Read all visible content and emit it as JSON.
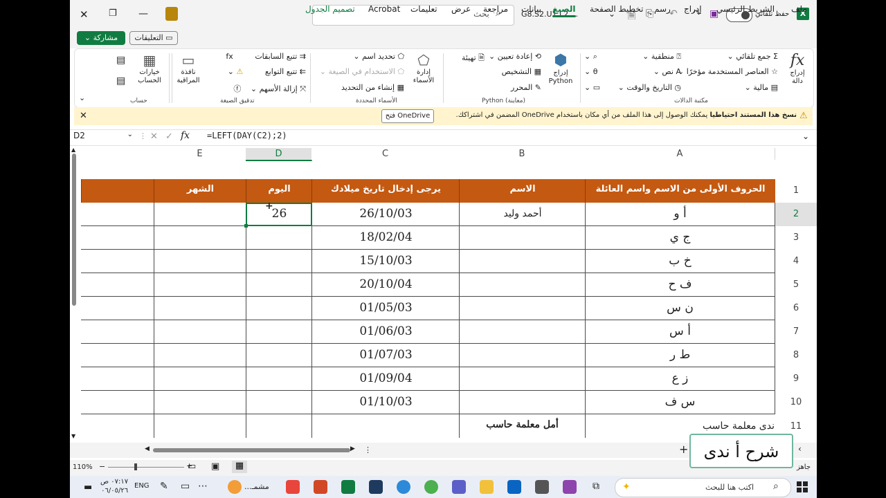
{
  "titlebar": {
    "search_placeholder": "بحث",
    "file_name": "G8.S2.U1.L2....",
    "autosave_label": "حفظ تلقائي",
    "logo_text": "X"
  },
  "tabs": [
    "ملف",
    "الشريط الرئيسي",
    "إدراج",
    "رسم",
    "تخطيط الصفحة",
    "الصيغ",
    "بيانات",
    "مراجعة",
    "عرض",
    "تعليمات",
    "Acrobat",
    "تصميم الجدول"
  ],
  "tab_active": "الصيغ",
  "share_label": "مشاركة",
  "comments_label": "التعليقات",
  "ribbon": {
    "insert_function": "إدراج دالة",
    "fx": "fx",
    "autosum": "جمع تلقائي",
    "recent": "العناصر المستخدمة مؤخرًا",
    "financial": "مالية",
    "logical": "منطقية",
    "text": "نص",
    "datetime": "التاريخ والوقت",
    "library_label": "مكتبة الدالات",
    "insert_python": "إدراج Python",
    "reset": "إعادة تعيين",
    "init": "تهيئة",
    "diagnostics": "التشخيص",
    "editor": "المحرر",
    "python_label": "Python (معاينة)",
    "name_manager": "إدارة الأسماء",
    "define_name": "تحديد اسم",
    "use_in_formula": "الاستخدام في الصيغة",
    "create_from_selection": "إنشاء من التحديد",
    "names_label": "الأسماء المحددة",
    "trace_precedents": "تتبع السابقات",
    "trace_dependents": "تتبع التوابع",
    "remove_arrows": "إزالة الأسهم",
    "auditing_label": "تدقيق الصيغة",
    "watch_window": "نافذة المراقبة",
    "calc_options": "خيارات الحساب",
    "calc_label": "حساب"
  },
  "notification": {
    "title": "نسخ هذا المستند احتياطيا",
    "message": "يمكنك الوصول إلى هذا الملف من أي مكان باستخدام OneDrive المضمن في اشتراكك.",
    "button": "فتح OneDrive"
  },
  "formula_bar": {
    "name_box": "D2",
    "fx": "fx",
    "formula": "=LEFT(DAY(C2);2)"
  },
  "columns": [
    "A",
    "B",
    "C",
    "D",
    "E"
  ],
  "rows": [
    "1",
    "2",
    "3",
    "4",
    "5",
    "6",
    "7",
    "8",
    "9",
    "10",
    "11"
  ],
  "table": {
    "headers": {
      "a": "الحروف الأولى من الاسم واسم العائلة",
      "b": "الاسم",
      "c": "يرجى إدخال تاريخ ميلادك",
      "d": "اليوم",
      "e": "الشهر"
    },
    "rows": [
      {
        "a": "أ و",
        "b": "أحمد وليد",
        "c": "26/10/03",
        "d": "26"
      },
      {
        "a": "ج ي",
        "b": "",
        "c": "18/02/04",
        "d": ""
      },
      {
        "a": "خ ب",
        "b": "",
        "c": "15/10/03",
        "d": ""
      },
      {
        "a": "ف ح",
        "b": "",
        "c": "20/10/04",
        "d": ""
      },
      {
        "a": "ن س",
        "b": "",
        "c": "01/05/03",
        "d": ""
      },
      {
        "a": "أ س",
        "b": "",
        "c": "01/06/03",
        "d": ""
      },
      {
        "a": "ط ر",
        "b": "",
        "c": "01/07/03",
        "d": ""
      },
      {
        "a": "ز ع",
        "b": "",
        "c": "01/09/04",
        "d": ""
      },
      {
        "a": "س ف",
        "b": "",
        "c": "01/10/03",
        "d": ""
      }
    ],
    "footer_a": "ندى معلمة حاسب",
    "footer_b": "أمل معلمة حاسب"
  },
  "caption": "شرح أ ندى",
  "status": {
    "ready": "جاهز",
    "zoom": "110%"
  },
  "taskbar": {
    "search_placeholder": "اكتب هنا للبحث",
    "time": "٠٧:١٧ ص",
    "date": "٠٦/٠٥/٢٦",
    "lang": "ENG",
    "app_label": "مشمـ..."
  },
  "colors": {
    "accent": "#107c41",
    "header_fill": "#c45911",
    "notify_bg": "#fff4ce"
  }
}
